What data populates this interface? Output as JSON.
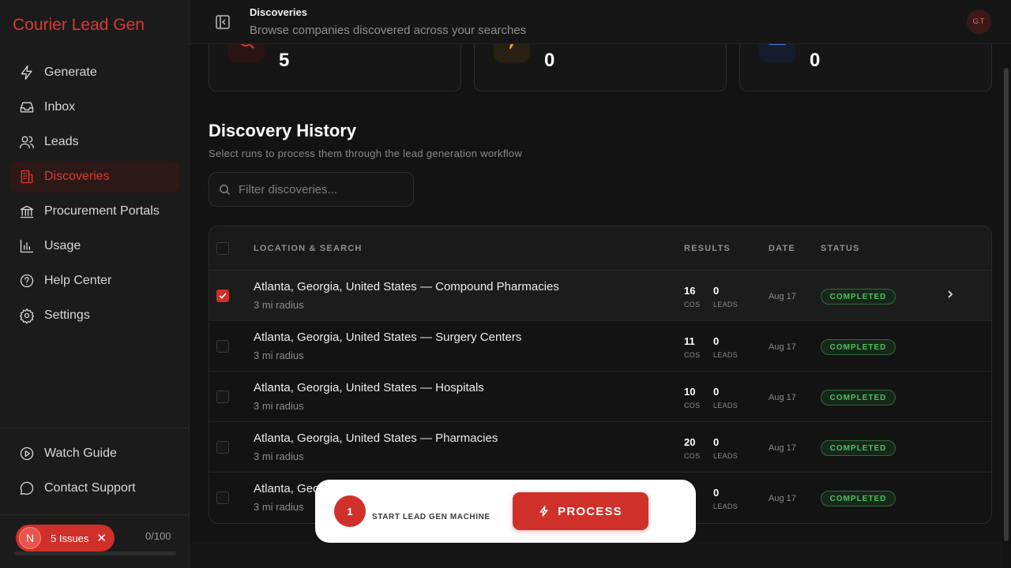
{
  "brand": "Courier Lead Gen",
  "nav": [
    {
      "label": "Generate",
      "icon": "zap-icon"
    },
    {
      "label": "Inbox",
      "icon": "inbox-icon"
    },
    {
      "label": "Leads",
      "icon": "users-icon"
    },
    {
      "label": "Discoveries",
      "icon": "building-icon",
      "active": true
    },
    {
      "label": "Procurement Portals",
      "icon": "landmark-icon"
    },
    {
      "label": "Usage",
      "icon": "bar-chart-icon"
    },
    {
      "label": "Help Center",
      "icon": "help-circle-icon"
    },
    {
      "label": "Settings",
      "icon": "gear-icon"
    }
  ],
  "footer_nav": [
    {
      "label": "Watch Guide",
      "icon": "play-circle-icon"
    },
    {
      "label": "Contact Support",
      "icon": "message-circle-icon"
    }
  ],
  "issues": {
    "avatar": "N",
    "label": "5 Issues",
    "usage": "0/100"
  },
  "header": {
    "title": "Discoveries",
    "subtitle": "Browse companies discovered across your searches",
    "avatar": "GT"
  },
  "stats": [
    {
      "value": "5",
      "icon": "search-icon",
      "color": "#d93a2f"
    },
    {
      "value": "0",
      "icon": "zap-icon",
      "color": "#e8a23a"
    },
    {
      "value": "0",
      "icon": "mail-icon",
      "color": "#4a7fe0"
    }
  ],
  "history": {
    "title": "Discovery History",
    "subtitle": "Select runs to process them through the lead generation workflow",
    "filter_placeholder": "Filter discoveries...",
    "columns": [
      "LOCATION & SEARCH",
      "RESULTS",
      "DATE",
      "STATUS"
    ],
    "rows": [
      {
        "location": "Atlanta, Georgia, United States — Compound Pharmacies",
        "radius": "3 mi radius",
        "cos": "16",
        "leads": "0",
        "cos_label": "COS",
        "leads_label": "LEADS",
        "date": "Aug 17",
        "status": "COMPLETED",
        "checked": true
      },
      {
        "location": "Atlanta, Georgia, United States — Surgery Centers",
        "radius": "3 mi radius",
        "cos": "11",
        "leads": "0",
        "cos_label": "COS",
        "leads_label": "LEADS",
        "date": "Aug 17",
        "status": "COMPLETED",
        "checked": false
      },
      {
        "location": "Atlanta, Georgia, United States — Hospitals",
        "radius": "3 mi radius",
        "cos": "10",
        "leads": "0",
        "cos_label": "COS",
        "leads_label": "LEADS",
        "date": "Aug 17",
        "status": "COMPLETED",
        "checked": false
      },
      {
        "location": "Atlanta, Georgia, United States — Pharmacies",
        "radius": "3 mi radius",
        "cos": "20",
        "leads": "0",
        "cos_label": "COS",
        "leads_label": "LEADS",
        "date": "Aug 17",
        "status": "COMPLETED",
        "checked": false
      },
      {
        "location": "Atlanta, Georgia, United States",
        "radius": "3 mi radius",
        "cos": "",
        "leads": "0",
        "cos_label": "",
        "leads_label": "LEADS",
        "date": "Aug 17",
        "status": "COMPLETED",
        "checked": false
      }
    ]
  },
  "process_bar": {
    "count": "1",
    "label": "START LEAD GEN MACHINE",
    "button": "PROCESS"
  }
}
